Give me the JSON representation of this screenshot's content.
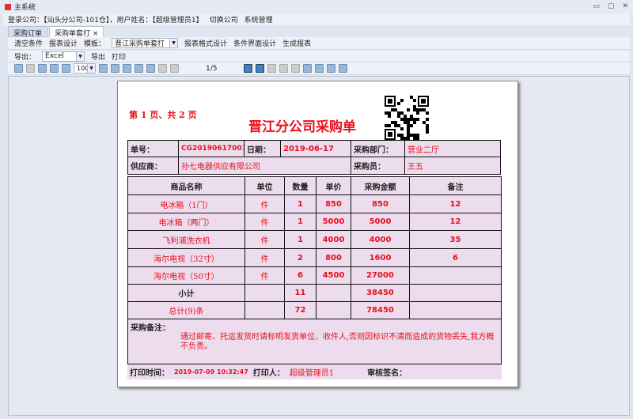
{
  "window": {
    "title": "主系统"
  },
  "info": {
    "login_company": "登录公司：【汕头分公司-101仓】，用户姓名：【超级管理员1】",
    "switch_company": "切换公司",
    "system_manage": "系统管理"
  },
  "tabs": [
    {
      "label": "采购订单"
    },
    {
      "label": "采购单套打",
      "close": "×"
    }
  ],
  "toolbar1": {
    "clear": "清空条件",
    "report_design": "报表设计",
    "template_label": "模板：",
    "template_value": "晋江采购单套打",
    "format_design": "报表格式设计",
    "condition_design": "条件界面设计",
    "generate": "生成报表"
  },
  "toolbar2": {
    "export_label": "导出：",
    "export_value": "Excel",
    "export": "导出",
    "print": "打印"
  },
  "toolbar3": {
    "zoom": "100%",
    "page": "1/5"
  },
  "report": {
    "page_info": "第 1 页、共 2 页",
    "title": "晋江分公司采购单",
    "order_no_label": "单号：",
    "order_no": "CG20190617001",
    "date_label": "日期：",
    "date": "2019-06-17",
    "dept_label": "采购部门：",
    "dept": "营业二厅",
    "supplier_label": "供应商：",
    "supplier": "孙七电器供应有限公司",
    "buyer_label": "采购员：",
    "buyer": "王五",
    "columns": [
      "商品名称",
      "单位",
      "数量",
      "单价",
      "采购金额",
      "备注"
    ],
    "rows": [
      [
        "电冰箱（1门）",
        "件",
        "1",
        "850",
        "850",
        "12"
      ],
      [
        "电冰箱（两门）",
        "件",
        "1",
        "5000",
        "5000",
        "12"
      ],
      [
        "飞利浦洗衣机",
        "件",
        "1",
        "4000",
        "4000",
        "35"
      ],
      [
        "海尔电视（32寸）",
        "件",
        "2",
        "800",
        "1600",
        "6"
      ],
      [
        "海尔电视（50寸）",
        "件",
        "6",
        "4500",
        "27000",
        ""
      ]
    ],
    "subtotal": {
      "label": "小计",
      "qty": "11",
      "amount": "38450"
    },
    "total": {
      "label": "总计(9)条",
      "qty": "72",
      "amount": "78450"
    },
    "remark_label": "采购备注：",
    "remark": "通过邮寄、托运发货时请标明发货单位、收件人,否则因标识不清而造成的货物丢失,我方概不负责。",
    "print_time_label": "打印时间：",
    "print_time": "2019-07-09 10:32:47",
    "printer_label": "打印人：",
    "printer": "超级管理员1",
    "audit_label": "审核签名："
  }
}
